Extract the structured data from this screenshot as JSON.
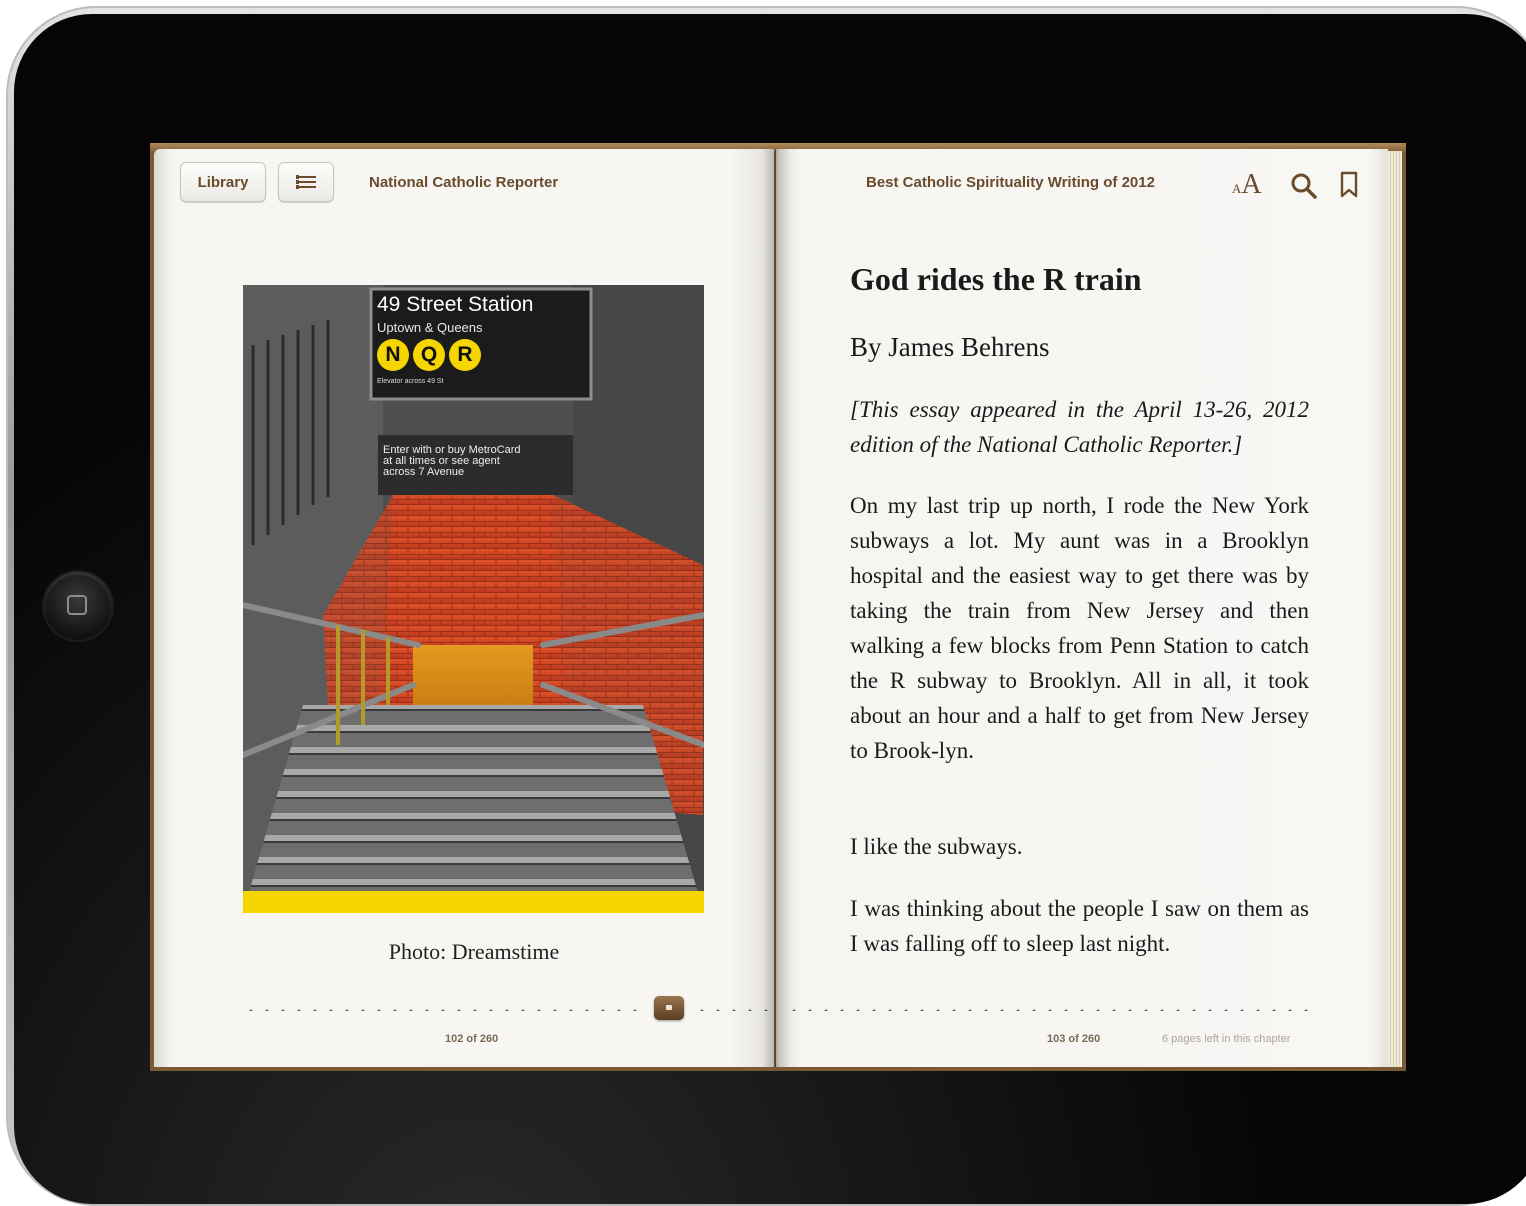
{
  "toolbar": {
    "library_label": "Library",
    "toc_icon": "list-icon",
    "left_title": "National Catholic Reporter",
    "right_title": "Best Catholic Spirituality Writing of 2012",
    "font_size_icon": "font-size-icon",
    "font_size_label_small": "A",
    "font_size_label_large": "A",
    "search_icon": "search-icon",
    "bookmark_icon": "bookmark-icon"
  },
  "left_page": {
    "photo": {
      "sign_title": "49 Street Station",
      "sign_subtitle": "Uptown & Queens",
      "lines": [
        "N",
        "Q",
        "R"
      ],
      "sign_note": "Elevator across 49 St",
      "entry_sign_line1": "Enter with or buy MetroCard",
      "entry_sign_line2": "at all times or see agent",
      "entry_sign_line3": "across 7 Avenue"
    },
    "caption": "Photo: Dreamstime",
    "page_number": "102 of 260"
  },
  "right_page": {
    "title": "God rides the R train",
    "byline": "By James Behrens",
    "note": "[This essay appeared in the April 13-26, 2012 edition of the National Catholic Reporter.]",
    "paragraphs": [
      "On my last trip up north, I rode the New York subways a lot. My aunt was in a Brooklyn hospital and the easiest way to get there was by taking the train from New Jersey and then walking a few blocks from Penn Station to catch the R subway to Brooklyn. All in all, it took about an hour and a half to get from New Jersey to Brook-lyn.",
      "I like the subways.",
      "I was thinking about the people I saw on them as I was falling off to sleep last night."
    ],
    "page_number": "103 of 260",
    "pages_left": "6 pages left in this chapter"
  },
  "colors": {
    "accent_brown": "#6a4b2b",
    "subway_yellow": "#f5d600",
    "brick_red": "#d84a25"
  }
}
